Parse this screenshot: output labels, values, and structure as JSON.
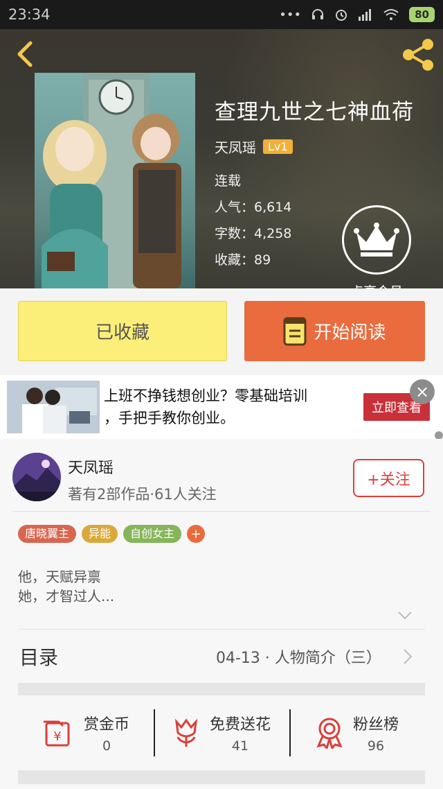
{
  "status_bar": {
    "time": "23:34",
    "battery": "80"
  },
  "book": {
    "title": "查理九世之七神血荷",
    "author": "天凤瑶",
    "level": "Lv1",
    "status": "连载",
    "popularity": "人气：6,614",
    "words": "字数：4,258",
    "favorites": "收藏：89"
  },
  "vip": {
    "label": "点亮会员"
  },
  "actions": {
    "collected": "已收藏",
    "read": "开始阅读"
  },
  "ad": {
    "line1": "上班不挣钱想创业？零基础培训",
    "line2": "，手把手教你创业。",
    "cta": "立即查看",
    "close": "×"
  },
  "author_panel": {
    "name": "天凤瑶",
    "subtitle": "著有2部作品·61人关注",
    "follow": "+关注"
  },
  "tags": [
    {
      "label": "唐晓翼主",
      "color": "#d9654e"
    },
    {
      "label": "异能",
      "color": "#d9a93a"
    },
    {
      "label": "自创女主",
      "color": "#86b55a"
    }
  ],
  "tag_more": "+",
  "intro": {
    "line1": "他，天赋异禀",
    "line2": "她，才智过人..."
  },
  "toc": {
    "label": "目录",
    "latest": "04-13 · 人物简介（三）"
  },
  "stats": [
    {
      "label": "赏金币",
      "value": "0",
      "icon": "coin-envelope-icon"
    },
    {
      "label": "免费送花",
      "value": "41",
      "icon": "flower-icon"
    },
    {
      "label": "粉丝榜",
      "value": "96",
      "icon": "medal-icon"
    }
  ],
  "colors": {
    "accent_orange": "#ea6b3d",
    "collected_yellow": "#fbef7a",
    "follow_red": "#d9403a",
    "icon_red": "#d9403a"
  }
}
